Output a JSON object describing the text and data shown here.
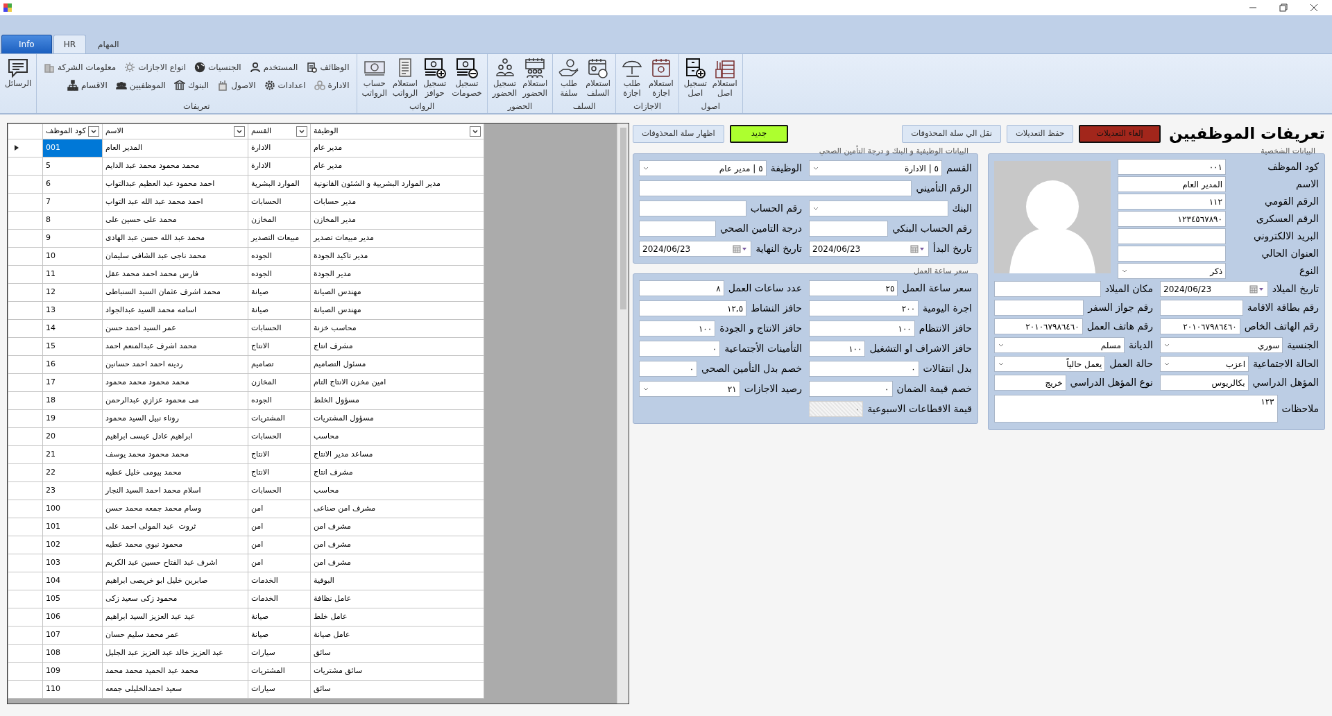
{
  "ribbon": {
    "tabs": [
      {
        "label": "المهام",
        "kind": "tab",
        "selected": false
      },
      {
        "label": "HR",
        "kind": "tab",
        "selected": true
      },
      {
        "label": "Info",
        "kind": "backstage",
        "selected": false
      }
    ],
    "groups": [
      {
        "kind": "large",
        "title": "اصول",
        "items": [
          {
            "label": "استعلام اصل"
          },
          {
            "label": "تسجيل اصل"
          }
        ]
      },
      {
        "kind": "large",
        "title": "الاجازات",
        "items": [
          {
            "label": "استعلام اجازة"
          },
          {
            "label": "طلب اجازة"
          }
        ]
      },
      {
        "kind": "large",
        "title": "السلف",
        "items": [
          {
            "label": "استعلام السلف"
          },
          {
            "label": "طلب سلفة"
          }
        ]
      },
      {
        "kind": "large",
        "title": "الحضور",
        "items": [
          {
            "label": "استعلام الحضور"
          },
          {
            "label": "تسجيل الحضور"
          }
        ]
      },
      {
        "kind": "large",
        "title": "الرواتب",
        "items": [
          {
            "label": "تسجيل خصومات"
          },
          {
            "label": "تسجيل حوافز"
          },
          {
            "label": "استعلام الرواتب"
          },
          {
            "label": "حساب الرواتب"
          }
        ]
      },
      {
        "kind": "small",
        "title": "تعريفات",
        "lines": [
          {
            "items": [
              {
                "label": "الوظائف"
              },
              {
                "label": "المستخدم"
              },
              {
                "label": "الجنسيات"
              },
              {
                "label": "انواع الاجازات"
              },
              {
                "label": "معلومات الشركة"
              }
            ]
          },
          {
            "items": [
              {
                "label": "الادارة"
              },
              {
                "label": "اعدادات"
              },
              {
                "label": "الاصول"
              },
              {
                "label": "البنوك"
              },
              {
                "label": "الموظفيين"
              },
              {
                "label": "الاقسام"
              }
            ]
          }
        ]
      },
      {
        "kind": "large",
        "items": [
          {
            "label": "الرسائل"
          }
        ]
      }
    ]
  },
  "table": {
    "columns": [
      "الوظيفة",
      "القسم",
      "الاسم",
      "كود الموظف"
    ],
    "rows": [
      {
        "selected": true,
        "cells": [
          "مدير عام",
          "الادارة",
          "المدير العام",
          "001"
        ]
      },
      {
        "selected": false,
        "cells": [
          "مدير عام",
          "الادارة",
          "محمد محمود محمد عبد الدايم",
          "5"
        ]
      },
      {
        "selected": false,
        "cells": [
          "مدير الموارد البشريية و الشئون القانونية",
          "الموارد البشرية",
          "احمد محمود عبد العظيم عبدالتواب",
          "6"
        ]
      },
      {
        "selected": false,
        "cells": [
          "مدير حسابات",
          "الحسابات",
          "احمد محمد عبد الله عبد التواب",
          "7"
        ]
      },
      {
        "selected": false,
        "cells": [
          "مدير المخازن",
          "المخازن",
          "محمد على حسين على",
          "8"
        ]
      },
      {
        "selected": false,
        "cells": [
          "مدير مبيعات تصدير",
          "مبيعات التصدير",
          "محمد عبد الله حسن عبد الهادى",
          "9"
        ]
      },
      {
        "selected": false,
        "cells": [
          "مدير تاكيد الجودة",
          "الجوده",
          "محمد ناجى عبد الشافى سليمان",
          "10"
        ]
      },
      {
        "selected": false,
        "cells": [
          "مدير الجودة",
          "الجوده",
          "فارس محمد احمد محمد عقل",
          "11"
        ]
      },
      {
        "selected": false,
        "cells": [
          "مهندس الصيانة",
          "صيانة",
          "محمد اشرف عثمان السيد السنباطى",
          "12"
        ]
      },
      {
        "selected": false,
        "cells": [
          "مهندس الصيانة",
          "صيانة",
          "اسامه محمد السيد عبدالجواد",
          "13"
        ]
      },
      {
        "selected": false,
        "cells": [
          "محاسب خزنة",
          "الحسابات",
          "عمر السيد احمد حسن",
          "14"
        ]
      },
      {
        "selected": false,
        "cells": [
          "مشرف انتاج",
          "الانتاج",
          "محمد اشرف عبدالمنعم احمد",
          "15"
        ]
      },
      {
        "selected": false,
        "cells": [
          "مسئول التصاميم",
          "تصاميم",
          "ردينه احمد احمد حسانين",
          "16"
        ]
      },
      {
        "selected": false,
        "cells": [
          "امين مخزن الانتاج التام",
          "المخازن",
          "محمد محمود محمد محمود",
          "17"
        ]
      },
      {
        "selected": false,
        "cells": [
          "مسؤول الخلط",
          "الجوده",
          "مى محمود عزازي عبدالرحمن",
          "18"
        ]
      },
      {
        "selected": false,
        "cells": [
          "مسؤول المشتريات",
          "المشتريات",
          "روناء نبيل السيد محمود",
          "19"
        ]
      },
      {
        "selected": false,
        "cells": [
          "محاسب",
          "الحسابات",
          "ابراهيم عادل عيسى ابراهيم",
          "20"
        ]
      },
      {
        "selected": false,
        "cells": [
          "مساعد مدير الانتاج",
          "الانتاج",
          "محمد محمود محمد يوسف",
          "21"
        ]
      },
      {
        "selected": false,
        "cells": [
          "مشرف انتاج",
          "الانتاج",
          "محمد بيومى خليل عطيه",
          "22"
        ]
      },
      {
        "selected": false,
        "cells": [
          "محاسب",
          "الحسابات",
          "اسلام محمد احمد السيد النجار",
          "23"
        ]
      },
      {
        "selected": false,
        "cells": [
          "مشرف امن صناعى",
          "امن",
          "وسام محمد جمعه محمد حسن",
          "100"
        ]
      },
      {
        "selected": false,
        "cells": [
          "مشرف امن",
          "امن",
          "ثروت  عبد المولى احمد على",
          "101"
        ]
      },
      {
        "selected": false,
        "cells": [
          "مشرف امن",
          "امن",
          "محمود نبوي محمد عطيه",
          "102"
        ]
      },
      {
        "selected": false,
        "cells": [
          "مشرف امن",
          "امن",
          "اشرف عبد الفتاح حسين عبد الكريم",
          "103"
        ]
      },
      {
        "selected": false,
        "cells": [
          "البوفية",
          "الخدمات",
          "صابرين خليل ابو خريصى ابراهيم",
          "104"
        ]
      },
      {
        "selected": false,
        "cells": [
          "عامل نظافة",
          "الخدمات",
          "محمود زكى سعيد زكى",
          "105"
        ]
      },
      {
        "selected": false,
        "cells": [
          "عامل خلط",
          "صيانة",
          "عيد عبد العزيز السيد ابراهيم",
          "106"
        ]
      },
      {
        "selected": false,
        "cells": [
          "عامل صيانة",
          "صيانة",
          "عمر محمد سليم حسان",
          "107"
        ]
      },
      {
        "selected": false,
        "cells": [
          "سائق",
          "سيارات",
          "عبد العزيز خالد عبد العزيز عبد الجليل",
          "108"
        ]
      },
      {
        "selected": false,
        "cells": [
          "سائق مشتريات",
          "المشتريات",
          "محمد عبد الحميد محمد محمد",
          "109"
        ]
      },
      {
        "selected": false,
        "cells": [
          "سائق",
          "سيارات",
          "سعيد احمدالخليلى جمعه",
          "110"
        ]
      }
    ]
  },
  "toolbar": {
    "title": "تعريفات الموظفيين",
    "right": [
      {
        "label": "إلغاء التعديلات",
        "kind": "cancel"
      },
      {
        "label": "حفظ التعديلات",
        "kind": "normal"
      },
      {
        "label": "نقل الي سلة المحذوفات",
        "kind": "normal"
      }
    ],
    "left": [
      {
        "label": "جديد",
        "kind": "new"
      },
      {
        "label": "اظهار سلة المحذوفات",
        "kind": "normal"
      }
    ]
  },
  "job_panel": {
    "title": "البيانات الوظيفية و البنك و درجة التأمين الصحي",
    "rows": [
      [
        {
          "label": "القسم",
          "kind": "combo",
          "value": "٥ | الادارة"
        },
        {
          "label": "الوظيفة",
          "kind": "combo",
          "value": "٥ | مدير عام"
        }
      ],
      [
        {
          "label": "الرقم التأميني",
          "kind": "wide"
        }
      ],
      [
        {
          "label": "البنك",
          "kind": "combo"
        },
        {
          "label": "رقم الحساب",
          "kind": "text"
        }
      ],
      [
        {
          "label": "رقم الحساب البنكي",
          "kind": "text"
        },
        {
          "label": "درجة التامين الصحي",
          "kind": "text"
        }
      ],
      [
        {
          "label": "تاريخ البدأ",
          "kind": "date",
          "value": "2024/06/23"
        },
        {
          "label": "تاريخ النهاية",
          "kind": "date",
          "value": "2024/06/23"
        }
      ]
    ]
  },
  "wage_panel": {
    "title": "سعر ساعة العمل",
    "rows": [
      [
        {
          "label": "سعر ساعة العمل",
          "kind": "text",
          "value": "٢٥",
          "disabled": false
        },
        {
          "label": "عدد ساعات العمل",
          "kind": "text",
          "value": "٨",
          "disabled": false
        }
      ],
      [
        {
          "label": "اجرة اليومية",
          "kind": "text",
          "value": "٢٠٠",
          "disabled": false
        },
        {
          "label": "حافز النشاط",
          "kind": "text",
          "value": "١٢,٥",
          "disabled": false
        }
      ],
      [
        {
          "label": "حافز الانتظام",
          "kind": "text",
          "value": "١٠٠",
          "disabled": false
        },
        {
          "label": "حافز الانتاج و الجودة",
          "kind": "text",
          "value": "١٠٠",
          "disabled": false
        }
      ],
      [
        {
          "label": "حافز الاشراف او التشغيل",
          "kind": "text",
          "value": "١٠٠",
          "disabled": false
        },
        {
          "label": "التأمينات الأجتماعية",
          "kind": "text",
          "value": "٠",
          "disabled": false
        }
      ],
      [
        {
          "label": "بدل انتقالات",
          "kind": "text",
          "value": "٠",
          "disabled": false
        },
        {
          "label": "خصم بدل التأمين الصحي",
          "kind": "text",
          "value": "٠",
          "disabled": false
        }
      ],
      [
        {
          "label": "خصم قيمة الضمان",
          "kind": "text",
          "value": "٠",
          "disabled": false
        },
        {
          "label": "رصيد الاجازات",
          "kind": "combo",
          "value": "٢١",
          "disabled": false
        }
      ],
      [
        {
          "label": "قيمة الاقطاعات الاسبوعية",
          "kind": "text",
          "value": "٠",
          "disabled": true
        }
      ]
    ]
  },
  "personal_panel": {
    "title": "البيانات الشخصية",
    "top_fields": [
      {
        "label": "كود الموظف",
        "kind": "text",
        "value": "٠٠١"
      },
      {
        "label": "الاسم",
        "kind": "text",
        "value": "المدير العام"
      },
      {
        "label": "الرقم القومي",
        "kind": "text",
        "value": "١١٢"
      },
      {
        "label": "الرقم العسكري",
        "kind": "text",
        "value": "١٢٣٤٥٦٧٨٩٠"
      },
      {
        "label": "البريد الالكتروني",
        "kind": "text"
      },
      {
        "label": "العنوان الحالي",
        "kind": "text"
      },
      {
        "label": "النوع",
        "kind": "combo",
        "value": "ذكر"
      }
    ],
    "rows": [
      [
        {
          "label": "تاريخ الميلاد",
          "kind": "date",
          "value": "2024/06/23"
        },
        {
          "label": "مكان الميلاد",
          "kind": "text"
        }
      ],
      [
        {
          "label": "رقم بطاقة الاقامة",
          "kind": "text"
        },
        {
          "label": "رقم جواز السفر",
          "kind": "text"
        }
      ],
      [
        {
          "label": "رقم الهاتف الخاص",
          "kind": "text",
          "value": "٢٠١٠٦٧٩٨٦٤٦٠"
        },
        {
          "label": "رقم هاتف العمل",
          "kind": "text",
          "value": "٢٠١٠٦٧٩٨٦٤٦٠"
        }
      ],
      [
        {
          "label": "الجنسية",
          "kind": "combo",
          "value": "سوري"
        },
        {
          "label": "الديانة",
          "kind": "combo",
          "value": "مسلم"
        }
      ],
      [
        {
          "label": "الحالة الاجتماعية",
          "kind": "combo",
          "value": "اعزب"
        },
        {
          "label": "حالة العمل",
          "kind": "combo",
          "value": "يعمل حالياً"
        }
      ],
      [
        {
          "label": "المؤهل الدراسي",
          "kind": "text",
          "value": "بكالريوس"
        },
        {
          "label": "نوع المؤهل الدراسي",
          "kind": "text",
          "value": "خريج"
        }
      ],
      [
        {
          "label": "ملاحظات",
          "kind": "textarea",
          "value": "١٢٣"
        }
      ]
    ]
  }
}
